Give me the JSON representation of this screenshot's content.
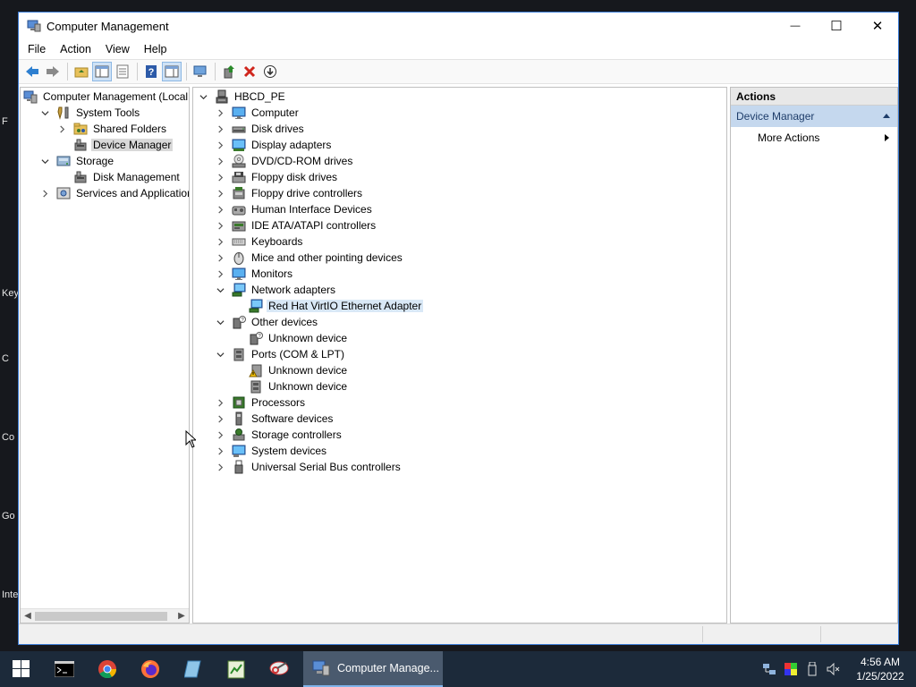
{
  "desktop": {
    "hints": [
      "F",
      "Key",
      "C",
      "Co",
      "Go",
      "Inte"
    ]
  },
  "window": {
    "title": "Computer Management",
    "controls": {
      "minimize": "—",
      "maximize": "☐",
      "close": "✕"
    }
  },
  "menu": [
    "File",
    "Action",
    "View",
    "Help"
  ],
  "left_tree": {
    "items": [
      {
        "label": "Computer Management (Local",
        "depth": 0,
        "expander": "none",
        "icon": "computer-management-icon"
      },
      {
        "label": "System Tools",
        "depth": 1,
        "expander": "open",
        "icon": "system-tools-icon"
      },
      {
        "label": "Shared Folders",
        "depth": 2,
        "expander": "closed",
        "icon": "shared-folders-icon"
      },
      {
        "label": "Device Manager",
        "depth": 2,
        "expander": "none",
        "icon": "device-manager-icon",
        "selected": true
      },
      {
        "label": "Storage",
        "depth": 1,
        "expander": "open",
        "icon": "storage-icon"
      },
      {
        "label": "Disk Management",
        "depth": 2,
        "expander": "none",
        "icon": "disk-management-icon"
      },
      {
        "label": "Services and Applications",
        "depth": 1,
        "expander": "closed",
        "icon": "services-icon"
      }
    ]
  },
  "device_tree": {
    "items": [
      {
        "label": "HBCD_PE",
        "depth": 0,
        "expander": "open",
        "icon": "computer-root-icon"
      },
      {
        "label": "Computer",
        "depth": 1,
        "expander": "closed",
        "icon": "monitor-icon"
      },
      {
        "label": "Disk drives",
        "depth": 1,
        "expander": "closed",
        "icon": "disk-drive-icon"
      },
      {
        "label": "Display adapters",
        "depth": 1,
        "expander": "closed",
        "icon": "display-adapter-icon"
      },
      {
        "label": "DVD/CD-ROM drives",
        "depth": 1,
        "expander": "closed",
        "icon": "dvd-drive-icon"
      },
      {
        "label": "Floppy disk drives",
        "depth": 1,
        "expander": "closed",
        "icon": "floppy-disk-icon"
      },
      {
        "label": "Floppy drive controllers",
        "depth": 1,
        "expander": "closed",
        "icon": "floppy-controller-icon"
      },
      {
        "label": "Human Interface Devices",
        "depth": 1,
        "expander": "closed",
        "icon": "hid-icon"
      },
      {
        "label": "IDE ATA/ATAPI controllers",
        "depth": 1,
        "expander": "closed",
        "icon": "ide-controller-icon"
      },
      {
        "label": "Keyboards",
        "depth": 1,
        "expander": "closed",
        "icon": "keyboard-icon"
      },
      {
        "label": "Mice and other pointing devices",
        "depth": 1,
        "expander": "closed",
        "icon": "mouse-icon"
      },
      {
        "label": "Monitors",
        "depth": 1,
        "expander": "closed",
        "icon": "monitor-icon"
      },
      {
        "label": "Network adapters",
        "depth": 1,
        "expander": "open",
        "icon": "network-adapter-icon"
      },
      {
        "label": "Red Hat VirtIO Ethernet Adapter",
        "depth": 2,
        "expander": "none",
        "icon": "network-adapter-icon",
        "selected": true
      },
      {
        "label": "Other devices",
        "depth": 1,
        "expander": "open",
        "icon": "other-devices-icon"
      },
      {
        "label": "Unknown device",
        "depth": 2,
        "expander": "none",
        "icon": "unknown-device-icon"
      },
      {
        "label": "Ports (COM & LPT)",
        "depth": 1,
        "expander": "open",
        "icon": "port-icon"
      },
      {
        "label": "Unknown device",
        "depth": 2,
        "expander": "none",
        "icon": "warning-device-icon"
      },
      {
        "label": "Unknown device",
        "depth": 2,
        "expander": "none",
        "icon": "port-icon"
      },
      {
        "label": "Processors",
        "depth": 1,
        "expander": "closed",
        "icon": "processor-icon"
      },
      {
        "label": "Software devices",
        "depth": 1,
        "expander": "closed",
        "icon": "software-device-icon"
      },
      {
        "label": "Storage controllers",
        "depth": 1,
        "expander": "closed",
        "icon": "storage-controller-icon"
      },
      {
        "label": "System devices",
        "depth": 1,
        "expander": "closed",
        "icon": "system-device-icon"
      },
      {
        "label": "Universal Serial Bus controllers",
        "depth": 1,
        "expander": "closed",
        "icon": "usb-icon"
      }
    ]
  },
  "actions": {
    "header": "Actions",
    "section": "Device Manager",
    "more": "More Actions"
  },
  "taskbar": {
    "active_task": "Computer Manage...",
    "time": "4:56 AM",
    "date": "1/25/2022"
  },
  "colors": {
    "selection": "#d9e8f6",
    "actions_section": "#c5d8ee",
    "taskbar": "#1c2a3a"
  }
}
